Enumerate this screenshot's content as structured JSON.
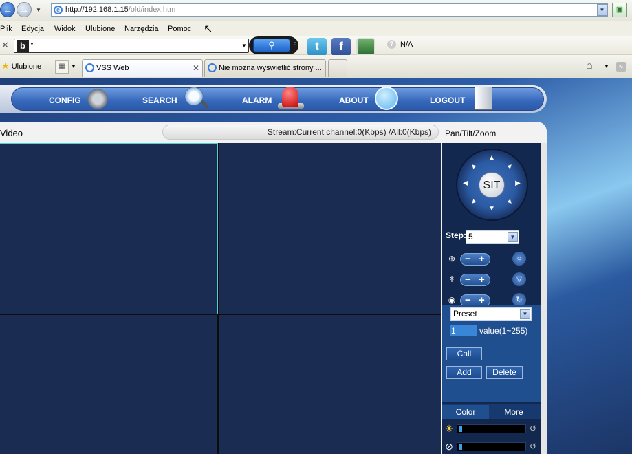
{
  "browser": {
    "url_host": "http://192.168.1.15",
    "url_path": "/old/index.htm",
    "menu": [
      "Plik",
      "Edycja",
      "Widok",
      "Ulubione",
      "Narzędzia",
      "Pomoc"
    ],
    "toolbar_status": "N/A",
    "favorites_label": "Ulubione",
    "tabs": [
      {
        "title": "VSS Web"
      },
      {
        "title": "Nie można wyświetlić strony ..."
      }
    ]
  },
  "nav": {
    "items": [
      {
        "label": "CONFIG",
        "icon": "gear-icon"
      },
      {
        "label": "SEARCH",
        "icon": "magnifier-icon"
      },
      {
        "label": "ALARM",
        "icon": "siren-icon"
      },
      {
        "label": "ABOUT",
        "icon": "smiley-icon"
      },
      {
        "label": "LOGOUT",
        "icon": "door-icon"
      }
    ]
  },
  "video": {
    "label": "Video",
    "stream_status": "Stream:Current channel:0(Kbps) /All:0(Kbps)"
  },
  "ptz": {
    "title": "Pan/Tilt/Zoom",
    "center_label": "SIT",
    "step_label": "Step:",
    "step_value": "5",
    "preset_select": "Preset",
    "preset_value": "1",
    "value_range_label": "value(1~255)",
    "call_label": "Call",
    "add_label": "Add",
    "delete_label": "Delete",
    "tabs": [
      "Color",
      "More"
    ],
    "brightness_level": 0.05,
    "contrast_level": 0.05
  },
  "colors": {
    "video_bg": "#1a2c52",
    "selected_border": "#4fd0d0",
    "nav_bar": "#3567ba"
  }
}
